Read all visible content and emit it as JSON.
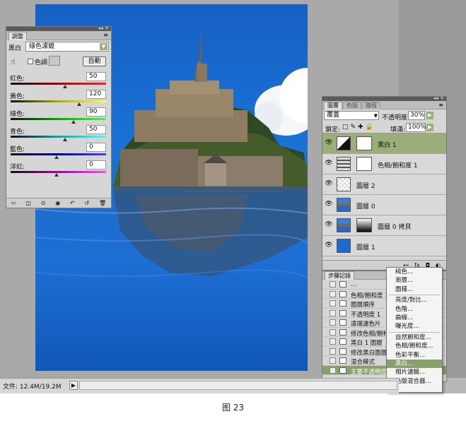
{
  "caption": "图 23",
  "status": {
    "doc_size": "文件: 12.4M/19.2M",
    "arrow": "▶"
  },
  "adjustments": {
    "tab": "調整",
    "menu_icon": "≡",
    "preset_label": "黑白",
    "preset_value": "綠色濾鏡",
    "tint_label": "色調",
    "auto_label": "自動",
    "sliders": [
      {
        "label": "紅色:",
        "value": "50",
        "pos": 0.57,
        "grad": "linear-gradient(90deg,#111,#a00,#f22)"
      },
      {
        "label": "黃色:",
        "value": "120",
        "pos": 0.72,
        "grad": "linear-gradient(90deg,#111,#aa0,#ff4)"
      },
      {
        "label": "綠色:",
        "value": "90",
        "pos": 0.66,
        "grad": "linear-gradient(90deg,#111,#0a0,#4f4)"
      },
      {
        "label": "青色:",
        "value": "50",
        "pos": 0.57,
        "grad": "linear-gradient(90deg,#111,#0aa,#4ff)"
      },
      {
        "label": "藍色:",
        "value": "0",
        "pos": 0.48,
        "grad": "linear-gradient(90deg,#111,#00a,#44f)"
      },
      {
        "label": "洋紅:",
        "value": "0",
        "pos": 0.48,
        "grad": "linear-gradient(90deg,#111,#a0a,#f4f)"
      }
    ]
  },
  "layers_panel": {
    "tabs": [
      "圖層",
      "色版",
      "路徑"
    ],
    "blend_mode": "覆蓋",
    "opacity_label": "不透明度:",
    "opacity": "30%",
    "lock_label": "鎖定:",
    "fill_label": "填滿:",
    "fill": "100%",
    "layers": [
      {
        "name": "黑白 1",
        "selected": true,
        "type": "adjustment-bw"
      },
      {
        "name": "色相/飽和度 1",
        "selected": false,
        "type": "adjustment-hue"
      },
      {
        "name": "圖層 2",
        "selected": false,
        "type": "transparent"
      },
      {
        "name": "圖層 0",
        "selected": false,
        "type": "photo"
      },
      {
        "name": "圖層 0 拷貝",
        "selected": false,
        "type": "photo-mask"
      },
      {
        "name": "圖層 1",
        "selected": false,
        "type": "blue"
      }
    ],
    "footer_icons": [
      "fx",
      "◘",
      "◐"
    ]
  },
  "history": {
    "tab": "步驟記錄",
    "items": [
      "…",
      "色相/飽和度 1",
      "圖層順序",
      "不透明度 1",
      "遠端濾色片",
      "修改色相/飽和",
      "黑白 1 圖層",
      "修改黑白圖層",
      "混合模式",
      "主要不透明度"
    ]
  },
  "context_menu": {
    "groups": [
      [
        "純色...",
        "漸層...",
        "圖樣..."
      ],
      [
        "亮度/對比...",
        "色階...",
        "曲線...",
        "曝光度..."
      ],
      [
        "自然飽和度...",
        "色相/飽和度...",
        "色彩平衡...",
        "黑白...",
        "相片濾鏡...",
        "色版混合器..."
      ]
    ],
    "highlighted": "黑白..."
  }
}
